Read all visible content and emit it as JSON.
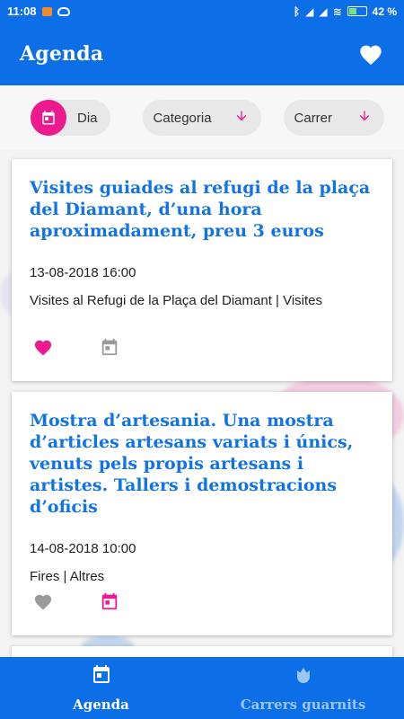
{
  "status_bar": {
    "time": "11:08",
    "battery": "42 %"
  },
  "app_bar": {
    "title": "Agenda",
    "favorites_icon": "heart-icon"
  },
  "filters": {
    "day_label": "Dia",
    "category_label": "Categoria",
    "street_label": "Carrer"
  },
  "events": [
    {
      "title": "Visites guiades al refugi de la plaça del Diamant, d’una hora aproximadament, preu 3 euros",
      "datetime": "13-08-2018 16:00",
      "place": "Visites al Refugi de la Plaça del Diamant | Visites",
      "favorite": true,
      "in_calendar": false
    },
    {
      "title": "Mostra d’artesania. Una mostra d’articles artesans variats i únics, venuts pels propis artesans i artistes. Tallers i demostracions d’oficis",
      "datetime": "14-08-2018 10:00",
      "place": "Fires | Altres",
      "favorite": false,
      "in_calendar": true
    }
  ],
  "bottom_nav": {
    "agenda": "Agenda",
    "streets": "Carrers guarnits"
  },
  "colors": {
    "primary": "#0d6fe8",
    "accent": "#ec1a8c",
    "title_blue": "#1273e6",
    "inactive_gray": "#9a9a9a"
  }
}
